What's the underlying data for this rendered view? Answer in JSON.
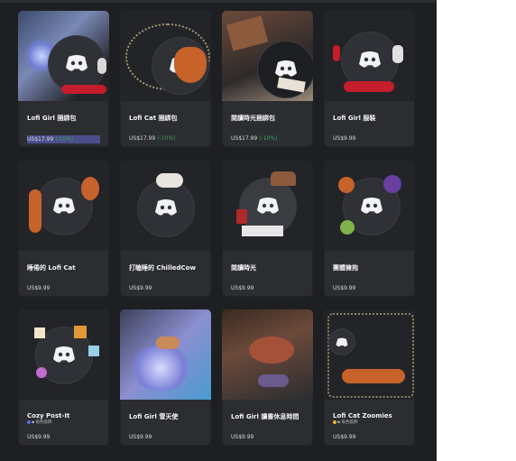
{
  "cards": [
    {
      "title": "Lofi Girl 捆綁包",
      "price": "US$17.99",
      "discount": "(-10%)",
      "subtitle": ""
    },
    {
      "title": "Lofi Cat 捆綁包",
      "price": "US$17.99",
      "discount": "(-10%)",
      "subtitle": ""
    },
    {
      "title": "閱讀時光捆綁包",
      "price": "US$17.99",
      "discount": "(-10%)",
      "subtitle": ""
    },
    {
      "title": "Lofi Girl 服裝",
      "price": "US$9.99",
      "discount": "",
      "subtitle": ""
    },
    {
      "title": "睡倦的 Lofi Cat",
      "price": "US$9.99",
      "discount": "",
      "subtitle": ""
    },
    {
      "title": "打瞌睡的 ChilledCow",
      "price": "US$9.99",
      "discount": "",
      "subtitle": ""
    },
    {
      "title": "閱讀時光",
      "price": "US$9.99",
      "discount": "",
      "subtitle": ""
    },
    {
      "title": "團體擁抱",
      "price": "US$9.99",
      "discount": "",
      "subtitle": ""
    },
    {
      "title": "Cozy Post-It",
      "price": "US$9.99",
      "discount": "",
      "subtitle": "▪ 角色裝飾"
    },
    {
      "title": "Lofi Girl 雪天使",
      "price": "US$9.99",
      "discount": "",
      "subtitle": ""
    },
    {
      "title": "Lofi Girl 讀書休息時間",
      "price": "US$9.99",
      "discount": "",
      "subtitle": ""
    },
    {
      "title": "Lofi Cat Zoomies",
      "price": "US$9.99",
      "discount": "",
      "subtitle": "▪ 角色裝飾"
    }
  ],
  "colors": {
    "background": "#1e1f22",
    "card": "#2b2d31",
    "discount": "#3ba55d"
  },
  "icons": [
    "discord-logo-icon"
  ]
}
